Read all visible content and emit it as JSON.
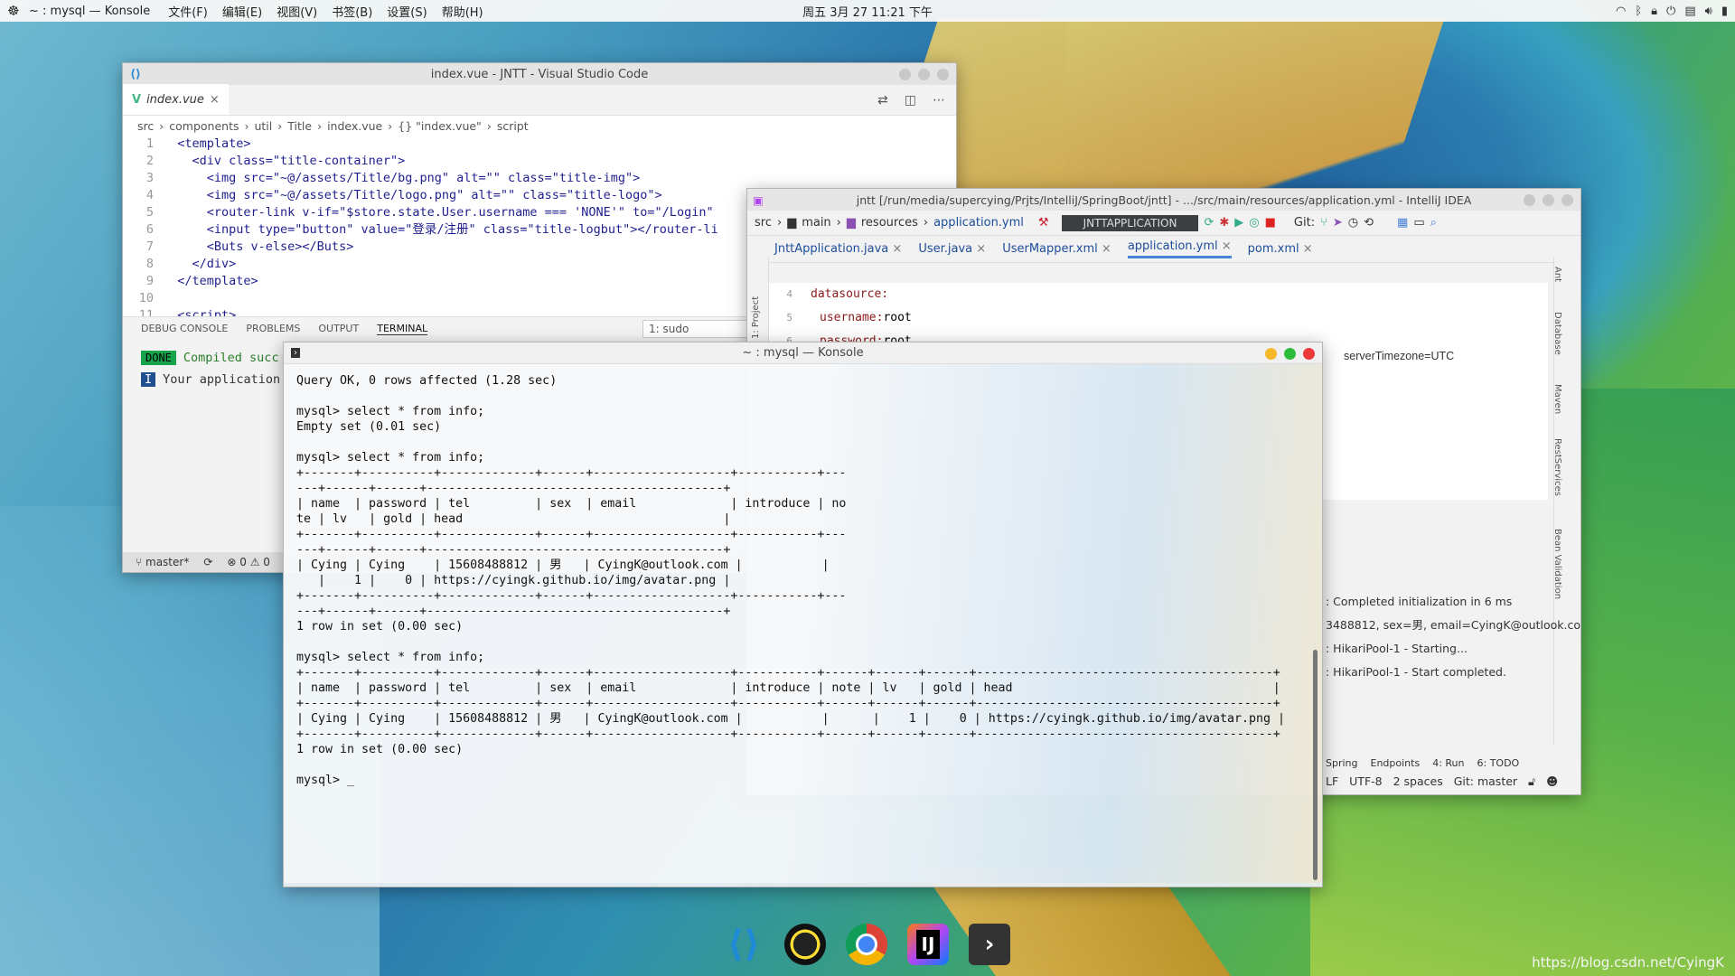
{
  "top_panel": {
    "app_title": "~ : mysql — Konsole",
    "menus": [
      "文件(F)",
      "编辑(E)",
      "视图(V)",
      "书签(B)",
      "设置(S)",
      "帮助(H)"
    ],
    "clock": "周五 3月 27 11:21 下午"
  },
  "vscode": {
    "title": "index.vue - JNTT - Visual Studio Code",
    "tab_label": "index.vue",
    "breadcrumb": [
      "src",
      "components",
      "util",
      "Title",
      "index.vue",
      "{} \"index.vue\"",
      "script"
    ],
    "code_lines": [
      {
        "n": "1",
        "t": "  <template>"
      },
      {
        "n": "2",
        "t": "    <div class=\"title-container\">"
      },
      {
        "n": "3",
        "t": "      <img src=\"~@/assets/Title/bg.png\" alt=\"\" class=\"title-img\">"
      },
      {
        "n": "4",
        "t": "      <img src=\"~@/assets/Title/logo.png\" alt=\"\" class=\"title-logo\">"
      },
      {
        "n": "5",
        "t": "      <router-link v-if=\"$store.state.User.username === 'NONE'\" to=\"/Login\""
      },
      {
        "n": "6",
        "t": "      <input type=\"button\" value=\"登录/注册\" class=\"title-logbut\"></router-li"
      },
      {
        "n": "7",
        "t": "      <Buts v-else></Buts>"
      },
      {
        "n": "8",
        "t": "    </div>"
      },
      {
        "n": "9",
        "t": "  </template>"
      },
      {
        "n": "10",
        "t": ""
      },
      {
        "n": "11",
        "t": "  <script>"
      }
    ],
    "panel_tabs": [
      "DEBUG CONSOLE",
      "PROBLEMS",
      "OUTPUT",
      "TERMINAL"
    ],
    "terminal_select": "1: sudo",
    "done_badge": "DONE",
    "compiled_text": "Compiled succ",
    "app_text": "Your application",
    "status_branch": "master*",
    "status_problems": "⊗ 0 ⚠ 0"
  },
  "idea": {
    "title": "jntt [/run/media/supercying/Prjts/IntelliJ/SpringBoot/jntt] - .../src/main/resources/application.yml - IntelliJ IDEA",
    "nav": [
      "src",
      "main",
      "resources",
      "application.yml"
    ],
    "run_config": "JNTTAPPLICATION",
    "git_label": "Git:",
    "tabs": [
      "JnttApplication.java",
      "User.java",
      "UserMapper.xml",
      "application.yml",
      "pom.xml"
    ],
    "editor_lines": [
      {
        "n": "4",
        "k": "datasource:",
        "v": ""
      },
      {
        "n": "5",
        "k": "username:",
        "v": " root"
      },
      {
        "n": "6",
        "k": "password:",
        "v": " root"
      }
    ],
    "server_tz": "serverTimezone=UTC",
    "log_lines": [
      ": Completed initialization in 6 ms",
      "3488812, sex=男, email=CyingK@outlook.com",
      ": HikariPool-1 - Starting...",
      ": HikariPool-1 - Start completed."
    ],
    "bottom_tabs": [
      "Spring",
      "Endpoints",
      "4: Run",
      "6: TODO"
    ],
    "status": [
      "LF",
      "UTF-8",
      "2 spaces",
      "Git: master"
    ],
    "right_tools": [
      "Ant",
      "Database",
      "Maven",
      "RestServices",
      "Bean Validation"
    ],
    "left_tools": [
      "1: Project"
    ]
  },
  "konsole": {
    "title": "~ : mysql — Konsole",
    "lines": [
      "Query OK, 0 rows affected (1.28 sec)",
      "",
      "mysql> select * from info;",
      "Empty set (0.01 sec)",
      "",
      "mysql> select * from info;",
      "+-------+----------+-------------+------+-------------------+-----------+---",
      "---+------+------+-----------------------------------------+",
      "| name  | password | tel         | sex  | email             | introduce | no",
      "te | lv   | gold | head                                    |",
      "+-------+----------+-------------+------+-------------------+-----------+---",
      "---+------+------+-----------------------------------------+",
      "| Cying | Cying    | 15608488812 | 男   | CyingK@outlook.com |           |",
      "   |    1 |    0 | https://cyingk.github.io/img/avatar.png |",
      "+-------+----------+-------------+------+-------------------+-----------+---",
      "---+------+------+-----------------------------------------+",
      "1 row in set (0.00 sec)",
      "",
      "mysql> select * from info;",
      "+-------+----------+-------------+------+-------------------+-----------+------+------+------+-----------------------------------------+",
      "| name  | password | tel         | sex  | email             | introduce | note | lv   | gold | head                                    |",
      "+-------+----------+-------------+------+-------------------+-----------+------+------+------+-----------------------------------------+",
      "| Cying | Cying    | 15608488812 | 男   | CyingK@outlook.com |           |      |    1 |    0 | https://cyingk.github.io/img/avatar.png |",
      "+-------+----------+-------------+------+-------------------+-----------+------+------+------+-----------------------------------------+",
      "1 row in set (0.00 sec)",
      "",
      "mysql> _"
    ]
  },
  "dock": [
    {
      "name": "vscode-icon",
      "label": "⟨⟩"
    },
    {
      "name": "qq-icon",
      "label": ""
    },
    {
      "name": "chrome-icon",
      "label": ""
    },
    {
      "name": "intellij-icon",
      "label": "IJ"
    },
    {
      "name": "terminal-icon",
      "label": "›"
    }
  ],
  "watermark": "https://blog.csdn.net/CyingK"
}
